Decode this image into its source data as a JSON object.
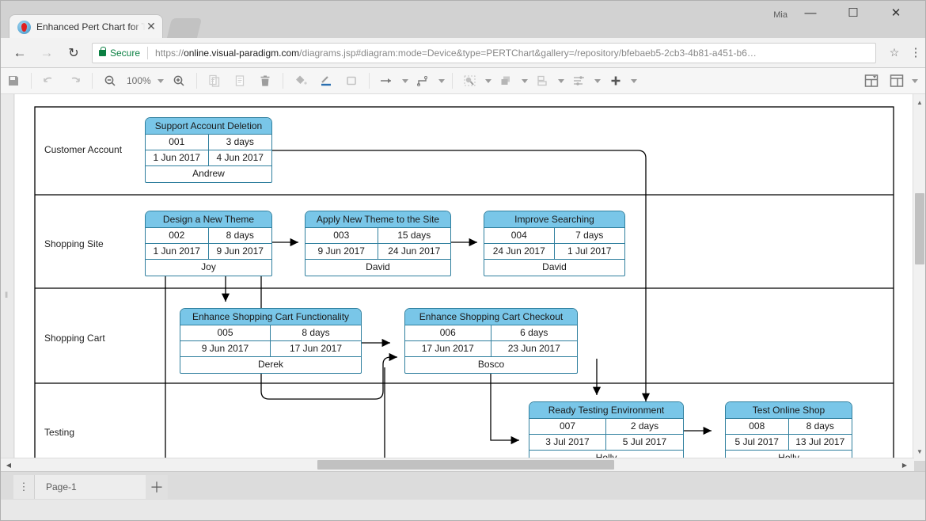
{
  "browser": {
    "tab_title": "Enhanced Pert Chart for T",
    "tab_close": "✕",
    "profile_name": "Mia",
    "minimize": "—",
    "maximize": "☐",
    "close": "✕",
    "back": "←",
    "forward": "→",
    "reload": "↻",
    "secure_label": "Secure",
    "url_scheme": "https://",
    "url_host": "online.visual-paradigm.com",
    "url_path": "/diagrams.jsp#diagram:mode=Device&type=PERTChart&gallery=/repository/bfebaeb5-2cb3-4b81-a451-b6…",
    "bookmark_star": "☆",
    "menu": "⋮"
  },
  "toolbar": {
    "save": "💾",
    "undo": "↶",
    "redo": "↷",
    "zoom_out": "🔍",
    "zoom_level": "100%",
    "zoom_in": "🔍",
    "copy": "❐",
    "paste": "⌸",
    "delete": "🗑",
    "fill_color": "◢",
    "line_color": "╱",
    "shape_style": "□",
    "connector_style": "→",
    "connector_route": "⌐",
    "select_tool": "❖",
    "arrange": "◰",
    "align": "⊞",
    "distribute": "≡",
    "add": "＋",
    "layout_panel": "▥",
    "view_panel": "▤"
  },
  "canvas": {
    "left_handle": "‖",
    "vscroll_up": "▲",
    "vscroll_down": "▼",
    "hscroll_left": "◀",
    "hscroll_right": "▶"
  },
  "pagebar": {
    "page_menu": "⋮",
    "page_tab": "Page-1",
    "add_page": "＋"
  },
  "colors": {
    "task_header_fill": "#79c6e8",
    "task_border": "#2f7f9e",
    "secure_green": "#0b8043",
    "lane_border": "#000000"
  },
  "chart_data": {
    "type": "diagram",
    "diagram_type": "PERT Chart (swimlane)",
    "lanes": [
      {
        "name": "Customer Account"
      },
      {
        "name": "Shopping Site"
      },
      {
        "name": "Shopping Cart"
      },
      {
        "name": "Testing"
      }
    ],
    "tasks": [
      {
        "id": "t001",
        "lane": "Customer Account",
        "title": "Support Account Deletion",
        "number": "001",
        "duration": "3 days",
        "start": "1 Jun 2017",
        "end": "4 Jun 2017",
        "owner": "Andrew"
      },
      {
        "id": "t002",
        "lane": "Shopping Site",
        "title": "Design a New Theme",
        "number": "002",
        "duration": "8 days",
        "start": "1 Jun 2017",
        "end": "9 Jun 2017",
        "owner": "Joy"
      },
      {
        "id": "t003",
        "lane": "Shopping Site",
        "title": "Apply New Theme to the Site",
        "number": "003",
        "duration": "15 days",
        "start": "9 Jun 2017",
        "end": "24 Jun 2017",
        "owner": "David"
      },
      {
        "id": "t004",
        "lane": "Shopping Site",
        "title": "Improve Searching",
        "number": "004",
        "duration": "7 days",
        "start": "24 Jun 2017",
        "end": "1 Jul 2017",
        "owner": "David"
      },
      {
        "id": "t005",
        "lane": "Shopping Cart",
        "title": "Enhance Shopping Cart Functionality",
        "number": "005",
        "duration": "8 days",
        "start": "9 Jun 2017",
        "end": "17 Jun 2017",
        "owner": "Derek"
      },
      {
        "id": "t006",
        "lane": "Shopping Cart",
        "title": "Enhance Shopping Cart Checkout",
        "number": "006",
        "duration": "6 days",
        "start": "17 Jun 2017",
        "end": "23 Jun 2017",
        "owner": "Bosco"
      },
      {
        "id": "t007",
        "lane": "Testing",
        "title": "Ready Testing Environment",
        "number": "007",
        "duration": "2 days",
        "start": "3 Jul 2017",
        "end": "5 Jul 2017",
        "owner": "Holly"
      },
      {
        "id": "t008",
        "lane": "Testing",
        "title": "Test Online Shop",
        "number": "008",
        "duration": "8 days",
        "start": "5 Jul 2017",
        "end": "13 Jul 2017",
        "owner": "Holly"
      }
    ],
    "dependencies": [
      {
        "from": "t001",
        "to": "t007"
      },
      {
        "from": "t002",
        "to": "t003"
      },
      {
        "from": "t003",
        "to": "t004"
      },
      {
        "from": "t002",
        "to": "t005"
      },
      {
        "from": "t005",
        "to": "t006"
      },
      {
        "from": "t002",
        "to": "t006"
      },
      {
        "from": "t004",
        "to": "t007"
      },
      {
        "from": "t006",
        "to": "t007"
      },
      {
        "from": "t007",
        "to": "t008"
      }
    ]
  }
}
